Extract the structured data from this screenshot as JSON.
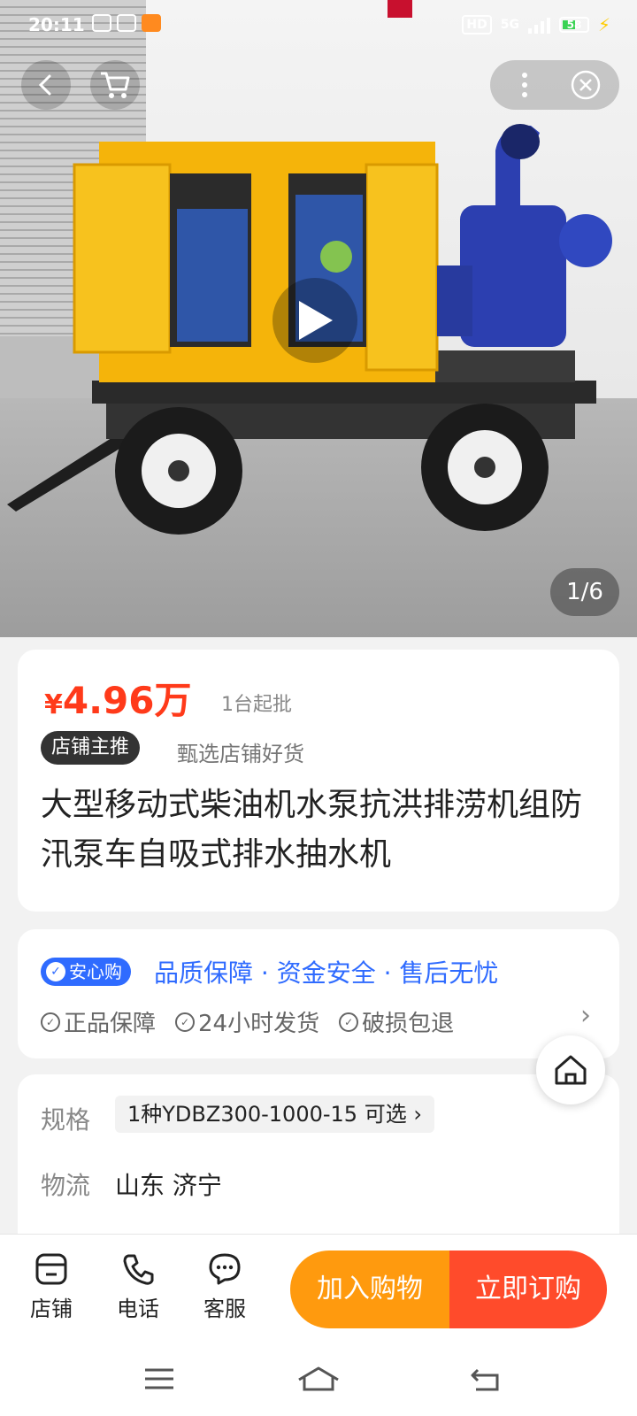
{
  "status_bar": {
    "time": "20:11",
    "network": "5G",
    "hd": "HD",
    "battery": "58"
  },
  "gallery": {
    "indicator": "1/6"
  },
  "product": {
    "price_symbol": "¥",
    "price_amount": "4.96万",
    "min_order": "1台起批",
    "shop_tag": "店铺主推",
    "shop_tag_desc": "甄选店铺好货",
    "title": "大型移动式柴油机水泵抗洪排涝机组防汛泵车自吸式排水抽水机"
  },
  "guarantee": {
    "badge": "安心购",
    "summary": "品质保障 · 资金安全 · 售后无忧",
    "items": [
      "正品保障",
      "24小时发货",
      "破损包退"
    ]
  },
  "spec": {
    "label": "规格",
    "value": "1种YDBZ300-1000-15 可选 ›",
    "logistics_label": "物流",
    "logistics_value": "山东 济宁"
  },
  "bottom_bar": {
    "shop": "店铺",
    "phone": "电话",
    "service": "客服",
    "add_cart": "加入购物",
    "buy_now": "立即订购"
  },
  "colors": {
    "price": "#ff3a1a",
    "assure_blue": "#2f6bff",
    "cart_orange": "#ff9a0e",
    "buy_red": "#ff4b2b"
  }
}
